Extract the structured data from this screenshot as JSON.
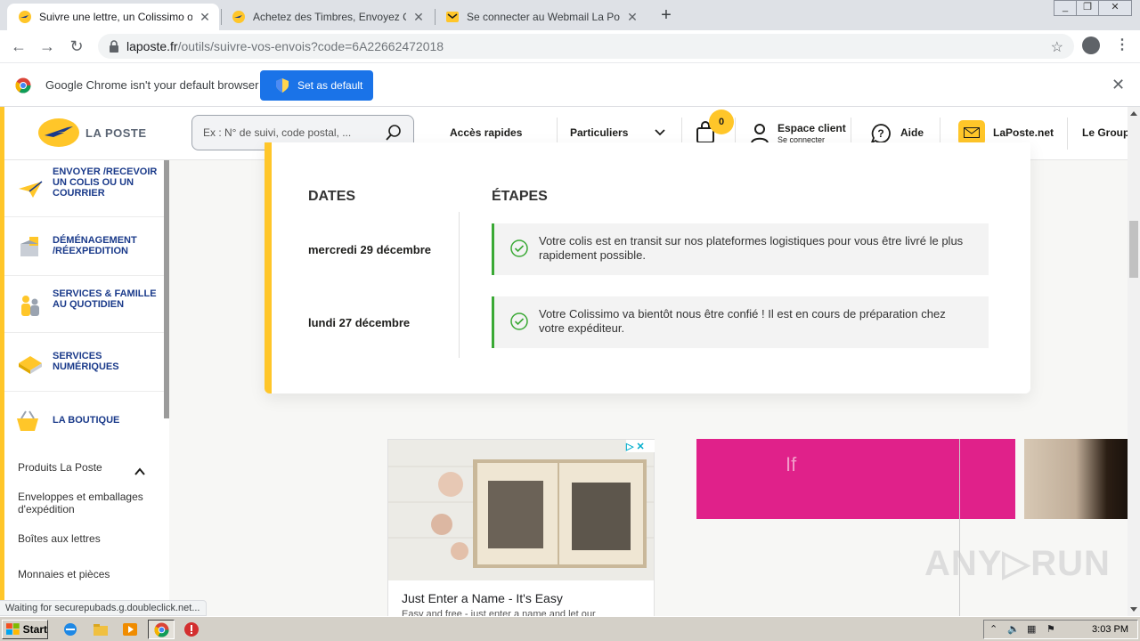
{
  "browser": {
    "tabs": [
      {
        "title": "Suivre une lettre, un Colissimo ou un",
        "active": true
      },
      {
        "title": "Achetez des Timbres, Envoyez Courr",
        "active": false
      },
      {
        "title": "Se connecter au Webmail La Poste -",
        "active": false
      }
    ],
    "new_tab": "+",
    "url_host": "laposte.fr",
    "url_path": "/outils/suivre-vos-envois?code=6A22662472018",
    "infobar_message": "Google Chrome isn't your default browser",
    "infobar_button": "Set as default",
    "status_text": "Waiting for securepubads.g.doubleclick.net...",
    "window_controls": [
      "_",
      "❐",
      "✕"
    ]
  },
  "site": {
    "logo_text": "LA POSTE",
    "search_placeholder": "Ex : N° de suivi, code postal, ...",
    "nav": {
      "quick_access": "Accès rapides",
      "particuliers": "Particuliers",
      "cart_count": "0",
      "espace_client": "Espace client",
      "se_connecter": "Se connecter",
      "aide": "Aide",
      "laposte_net": "LaPoste.net",
      "le_groupe": "Le Group"
    },
    "sidebar": {
      "items": [
        {
          "label": "ENVOYER /RECEVOIR UN COLIS OU UN COURRIER"
        },
        {
          "label": "DÉMÉNAGEMENT /RÉEXPEDITION"
        },
        {
          "label": "SERVICES & FAMILLE AU QUOTIDIEN"
        },
        {
          "label": "SERVICES NUMÉRIQUES"
        },
        {
          "label": "LA BOUTIQUE"
        }
      ],
      "boutique_links": [
        "Produits La Poste",
        "Enveloppes et emballages d'expédition",
        "Boîtes aux lettres",
        "Monnaies et pièces"
      ]
    },
    "tracking": {
      "dates_header": "DATES",
      "steps_header": "ÉTAPES",
      "events": [
        {
          "date": "mercredi 29 décembre",
          "text": "Votre colis est en transit sur nos plateformes logistiques pour vous être livré le plus rapidement possible."
        },
        {
          "date": "lundi 27 décembre",
          "text": "Votre Colissimo va bientôt nous être confié ! Il est en cours de préparation chez votre expéditeur."
        }
      ]
    },
    "ads": {
      "ad1_title": "Just Enter a Name - It's Easy",
      "ad1_sub": "Easy and free - just enter a name and let our",
      "ad2_text": "If",
      "adchoices": "▷ ✕"
    },
    "watermark": "ANY▷RUN"
  },
  "taskbar": {
    "start_label": "Start",
    "clock": "3:03 PM"
  },
  "colors": {
    "laposte_yellow": "#ffc629",
    "laposte_blue": "#1a3a8a",
    "step_green": "#3aa935",
    "chrome_blue": "#1a73e8",
    "ad_pink": "#e0218a"
  }
}
